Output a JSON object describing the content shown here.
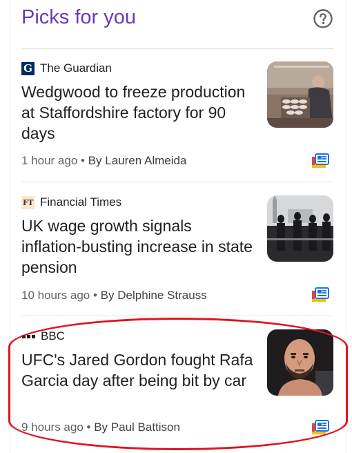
{
  "header": {
    "title": "Picks for you",
    "help_icon": "help-circle-icon"
  },
  "stories": [
    {
      "source": "The Guardian",
      "logo": "guardian-logo",
      "headline": "Wedgwood to freeze production at Staffordshire factory for 90 days",
      "time": "1 hour ago",
      "separator": "•",
      "author": "By Lauren Almeida",
      "thumbnail": "pottery-factory-worker-image",
      "coverage_icon": "full-coverage-icon"
    },
    {
      "source": "Financial Times",
      "logo": "ft-logo",
      "headline": "UK wage growth signals inflation-busting increase in state pension",
      "time": "10 hours ago",
      "separator": "•",
      "author": "By Delphine Strauss",
      "thumbnail": "london-commuters-bridge-image",
      "coverage_icon": "full-coverage-icon"
    },
    {
      "source": "BBC",
      "logo": "bbc-logo",
      "headline": "UFC's Jared Gordon fought Rafa Garcia day after being bit by car",
      "time": "9 hours ago",
      "separator": "•",
      "author": "By Paul Battison",
      "thumbnail": "fighter-portrait-image",
      "coverage_icon": "full-coverage-icon"
    }
  ],
  "colors": {
    "title": "#673ab7",
    "highlight": "#e0141e",
    "guardian": "#052962",
    "ft": "#fce5cf"
  }
}
